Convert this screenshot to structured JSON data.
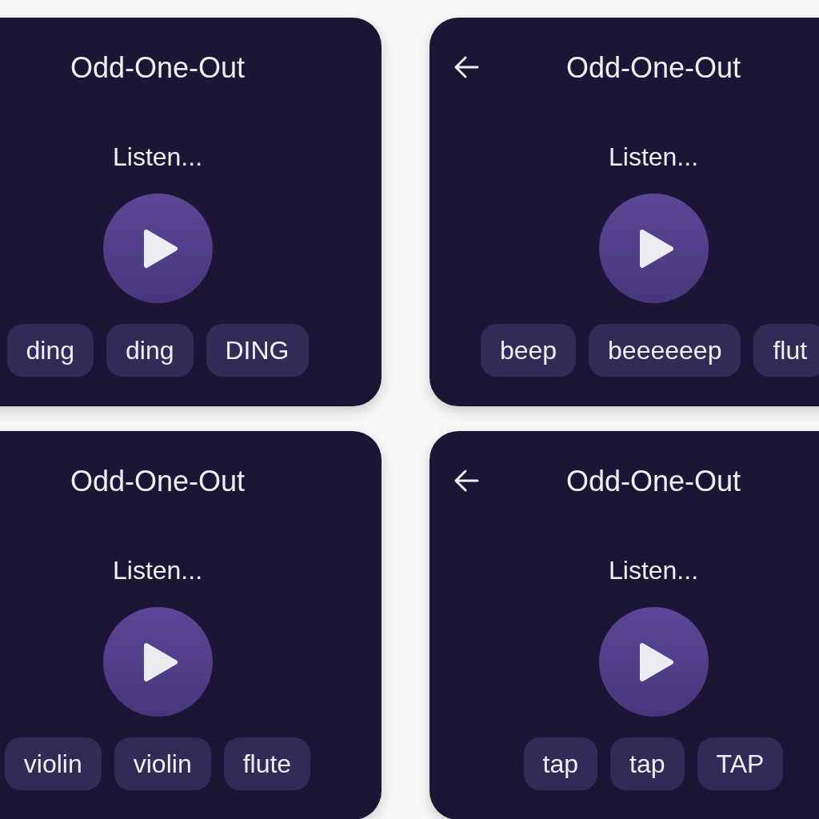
{
  "cards": [
    {
      "title": "Odd-One-Out",
      "prompt": "Listen...",
      "options": [
        "ding",
        "ding",
        "DING"
      ]
    },
    {
      "title": "Odd-One-Out",
      "show_back": true,
      "prompt": "Listen...",
      "options": [
        "beep",
        "beeeeeep",
        "flut"
      ]
    },
    {
      "title": "Odd-One-Out",
      "prompt": "Listen...",
      "options": [
        "violin",
        "violin",
        "flute"
      ]
    },
    {
      "title": "Odd-One-Out",
      "show_back": true,
      "prompt": "Listen...",
      "options": [
        "tap",
        "tap",
        "TAP"
      ]
    }
  ]
}
